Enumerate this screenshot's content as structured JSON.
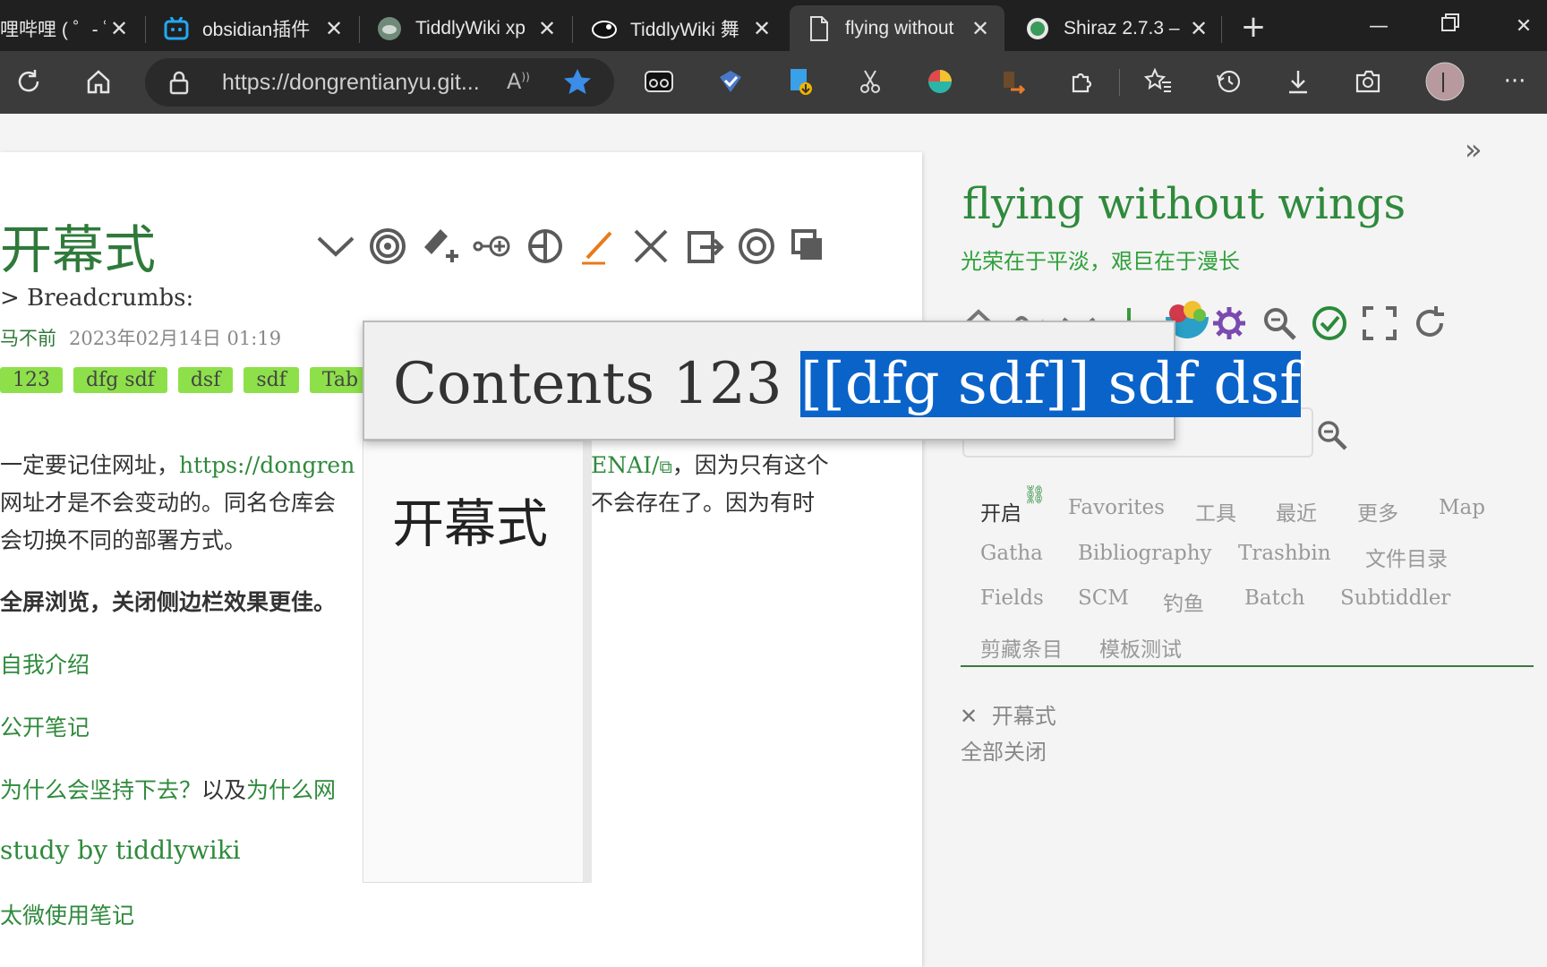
{
  "browser": {
    "tabs": [
      {
        "title": "哩哔哩 ( ゜- ゜)つ",
        "icon": "bilibili-icon"
      },
      {
        "title": "obsidian插件",
        "icon": "bilibili-tv-icon"
      },
      {
        "title": "TiddlyWiki xp",
        "icon": "tiddlywiki-icon"
      },
      {
        "title": "TiddlyWiki 舞",
        "icon": "tiddlywiki-cow-icon"
      },
      {
        "title": "flying without",
        "icon": "page-icon"
      },
      {
        "title": "Shiraz 2.7.3 –",
        "icon": "shiraz-icon"
      }
    ],
    "address": "https://dongrentianyu.git...",
    "colors": {
      "chrome_dark": "#202020",
      "chrome_toolbar": "#3b3b3b",
      "star": "#3b8de8"
    }
  },
  "tiddler": {
    "title": "开幕式",
    "breadcrumbs_label": "Breadcrumbs:",
    "author": "马不前",
    "date": "2023年02月14日 01:19",
    "tags": [
      "123",
      "dfg sdf",
      "dsf",
      "sdf",
      "Tab"
    ],
    "line1_pre": "一定要记住网址，",
    "line1_link": "https://dongren",
    "line1_link_end": "ENAI/",
    "line1_post": "，因为只有这个",
    "line2_pre": "网址才是不会变动的。同名仓库会",
    "line2_post": "不会存在了。因为有时",
    "line3": "会切换不同的部署方式。",
    "bold_line": "全屏浏览，关闭侧边栏效果更佳。",
    "links": [
      "自我介绍",
      "公开笔记"
    ],
    "why_link": "为什么会坚持下去？",
    "why_mid": "以及",
    "why_link2": "为什么网",
    "study_link": "study by tiddlywiki",
    "taiwei_link": "太微使用笔记",
    "accent": "#2f7a3a",
    "tag_color": "#8ee04b"
  },
  "sidebar": {
    "site_title": "flying without wings",
    "site_subtitle": "光荣在于平淡，艰巨在于漫长",
    "tabs_row1": [
      "开启",
      "Favorites",
      "工具",
      "最近",
      "更多",
      "Map"
    ],
    "tabs_row2": [
      "Gatha",
      "Bibliography",
      "Trashbin",
      "文件目录"
    ],
    "tabs_row3": [
      "Fields",
      "SCM",
      "钓鱼",
      "Batch",
      "Subtiddler"
    ],
    "tabs_row4": [
      "剪藏条目",
      "模板测试"
    ],
    "open_item": "开幕式",
    "close_all": "全部关闭"
  },
  "popup": {
    "prefix": "Contents 123 ",
    "selected": "[[dfg sdf]] sdf dsf",
    "body_title": "开幕式"
  }
}
